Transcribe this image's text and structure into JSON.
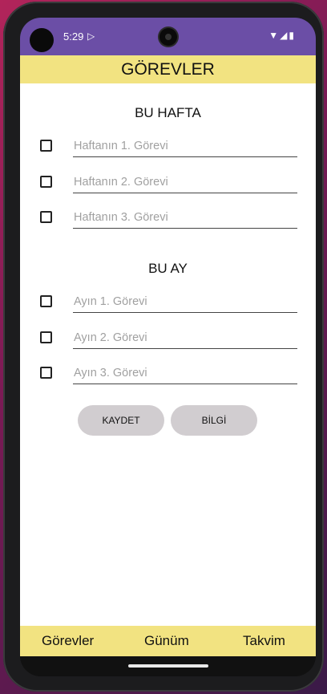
{
  "status_bar": {
    "time": "5:29",
    "play_icon": "play-protect-icon",
    "wifi_icon": "wifi-icon",
    "signal_icon": "signal-icon",
    "battery_icon": "battery-icon"
  },
  "header": {
    "title": "GÖREVLER"
  },
  "weekly": {
    "title": "BU HAFTA",
    "tasks": [
      {
        "placeholder": "Haftanın 1. Görevi",
        "checked": false
      },
      {
        "placeholder": "Haftanın 2. Görevi",
        "checked": false
      },
      {
        "placeholder": "Haftanın 3. Görevi",
        "checked": false
      }
    ]
  },
  "monthly": {
    "title": "BU AY",
    "tasks": [
      {
        "placeholder": "Ayın 1. Görevi",
        "checked": false
      },
      {
        "placeholder": "Ayın 2. Görevi",
        "checked": false
      },
      {
        "placeholder": "Ayın 3. Görevi",
        "checked": false
      }
    ]
  },
  "actions": {
    "save_label": "KAYDET",
    "info_label": "BİLGİ"
  },
  "bottom_nav": {
    "items": [
      {
        "label": "Görevler"
      },
      {
        "label": "Günüm"
      },
      {
        "label": "Takvim"
      }
    ]
  },
  "colors": {
    "status_bar": "#6b4ea6",
    "app_bar": "#f2e381",
    "button": "#d1cdd0",
    "placeholder": "#a0a0a0"
  }
}
